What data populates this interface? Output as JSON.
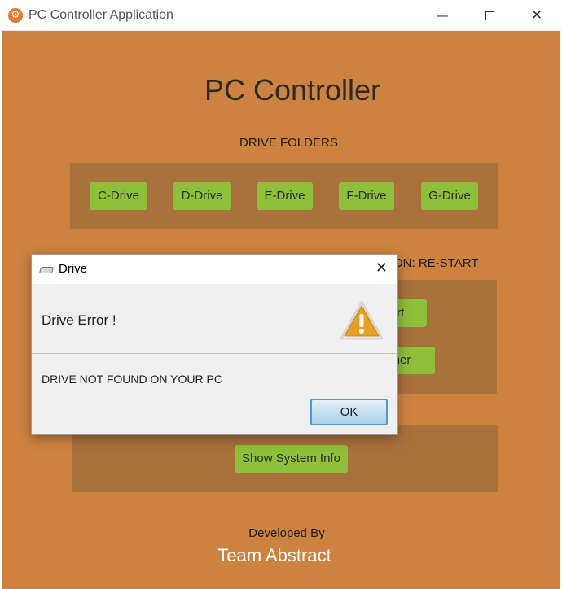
{
  "window": {
    "title": "PC Controller Application",
    "controls": {
      "minimize": "—",
      "close": "✕"
    }
  },
  "main": {
    "title": "PC Controller",
    "drive_section_label": "DRIVE FOLDERS",
    "drives": [
      "C-Drive",
      "D-Drive",
      "E-Drive",
      "F-Drive",
      "G-Drive"
    ],
    "power_section_label_visible": "ON: RE-START",
    "partial_buttons": [
      "Start",
      "Timer"
    ],
    "system_info_button": "Show System Info",
    "developed_by": "Developed By",
    "team": "Team Abstract"
  },
  "dialog": {
    "title": "Drive",
    "header": "Drive Error !",
    "message": "DRIVE NOT FOUND ON YOUR PC",
    "ok_label": "OK",
    "close_glyph": "✕"
  },
  "colors": {
    "background": "#cd833f",
    "panel": "#a9713c",
    "button": "#8ec03a",
    "warning": "#e8a020"
  }
}
